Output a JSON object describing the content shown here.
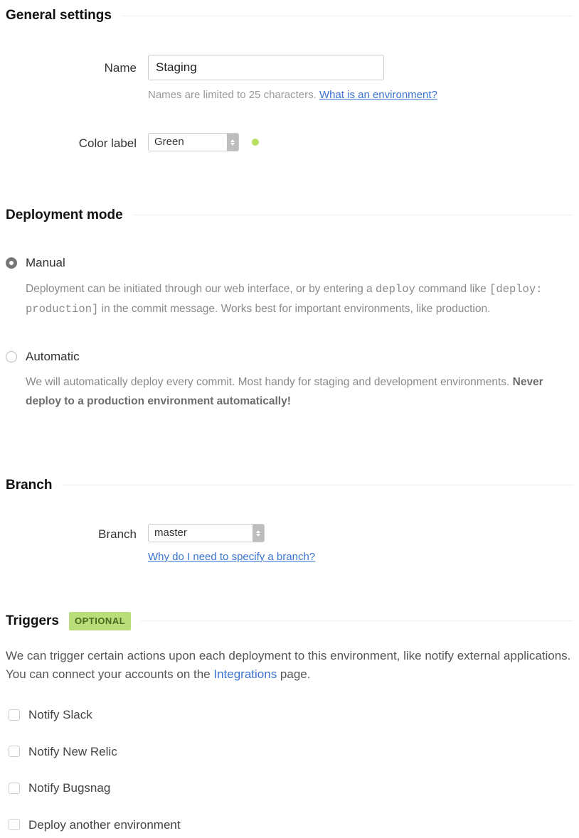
{
  "sections": {
    "general": "General settings",
    "deployment": "Deployment mode",
    "branch": "Branch",
    "triggers": "Triggers",
    "triggers_badge": "OPTIONAL"
  },
  "general": {
    "name_label": "Name",
    "name_value": "Staging",
    "name_help_prefix": "Names are limited to 25 characters. ",
    "name_help_link": "What is an environment?",
    "color_label": "Color label",
    "color_value": "Green",
    "swatch_hex": "#b7e060"
  },
  "deployment": {
    "manual": {
      "label": "Manual",
      "desc_pre": "Deployment can be initiated through our web interface, or by entering a ",
      "desc_code1": "deploy",
      "desc_mid": " command like ",
      "desc_code2": "[deploy: production]",
      "desc_post": " in the commit message. Works best for important environments, like production."
    },
    "automatic": {
      "label": "Automatic",
      "desc_pre": "We will automatically deploy every commit. Most handy for staging and development environments. ",
      "desc_bold": "Never deploy to a production environment automatically!"
    },
    "selected": "manual"
  },
  "branch": {
    "label": "Branch",
    "value": "master",
    "help_link": "Why do I need to specify a branch?"
  },
  "triggers": {
    "intro_pre": "We can trigger certain actions upon each deployment to this environment, like notify external applications. You can connect your accounts on the ",
    "intro_link": "Integrations",
    "intro_post": " page.",
    "items": [
      {
        "label": "Notify Slack"
      },
      {
        "label": "Notify New Relic"
      },
      {
        "label": "Notify Bugsnag"
      },
      {
        "label": "Deploy another environment"
      }
    ]
  }
}
